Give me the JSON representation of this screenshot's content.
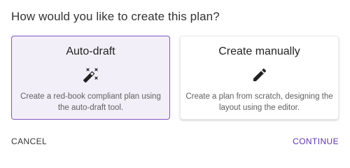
{
  "dialog": {
    "title": "How would you like to create this plan?"
  },
  "options": [
    {
      "title": "Auto-draft",
      "icon": "magic-wand-icon",
      "description": "Create a red-book compliant plan using the auto-draft tool.",
      "selected": true
    },
    {
      "title": "Create manually",
      "icon": "pencil-icon",
      "description": "Create a plan from scratch, designing the layout using the editor.",
      "selected": false
    }
  ],
  "actions": {
    "cancel_label": "CANCEL",
    "continue_label": "CONTINUE"
  },
  "colors": {
    "accent": "#5e35b1",
    "selected_border": "#7e57c2",
    "selected_background": "#f3eff8"
  }
}
